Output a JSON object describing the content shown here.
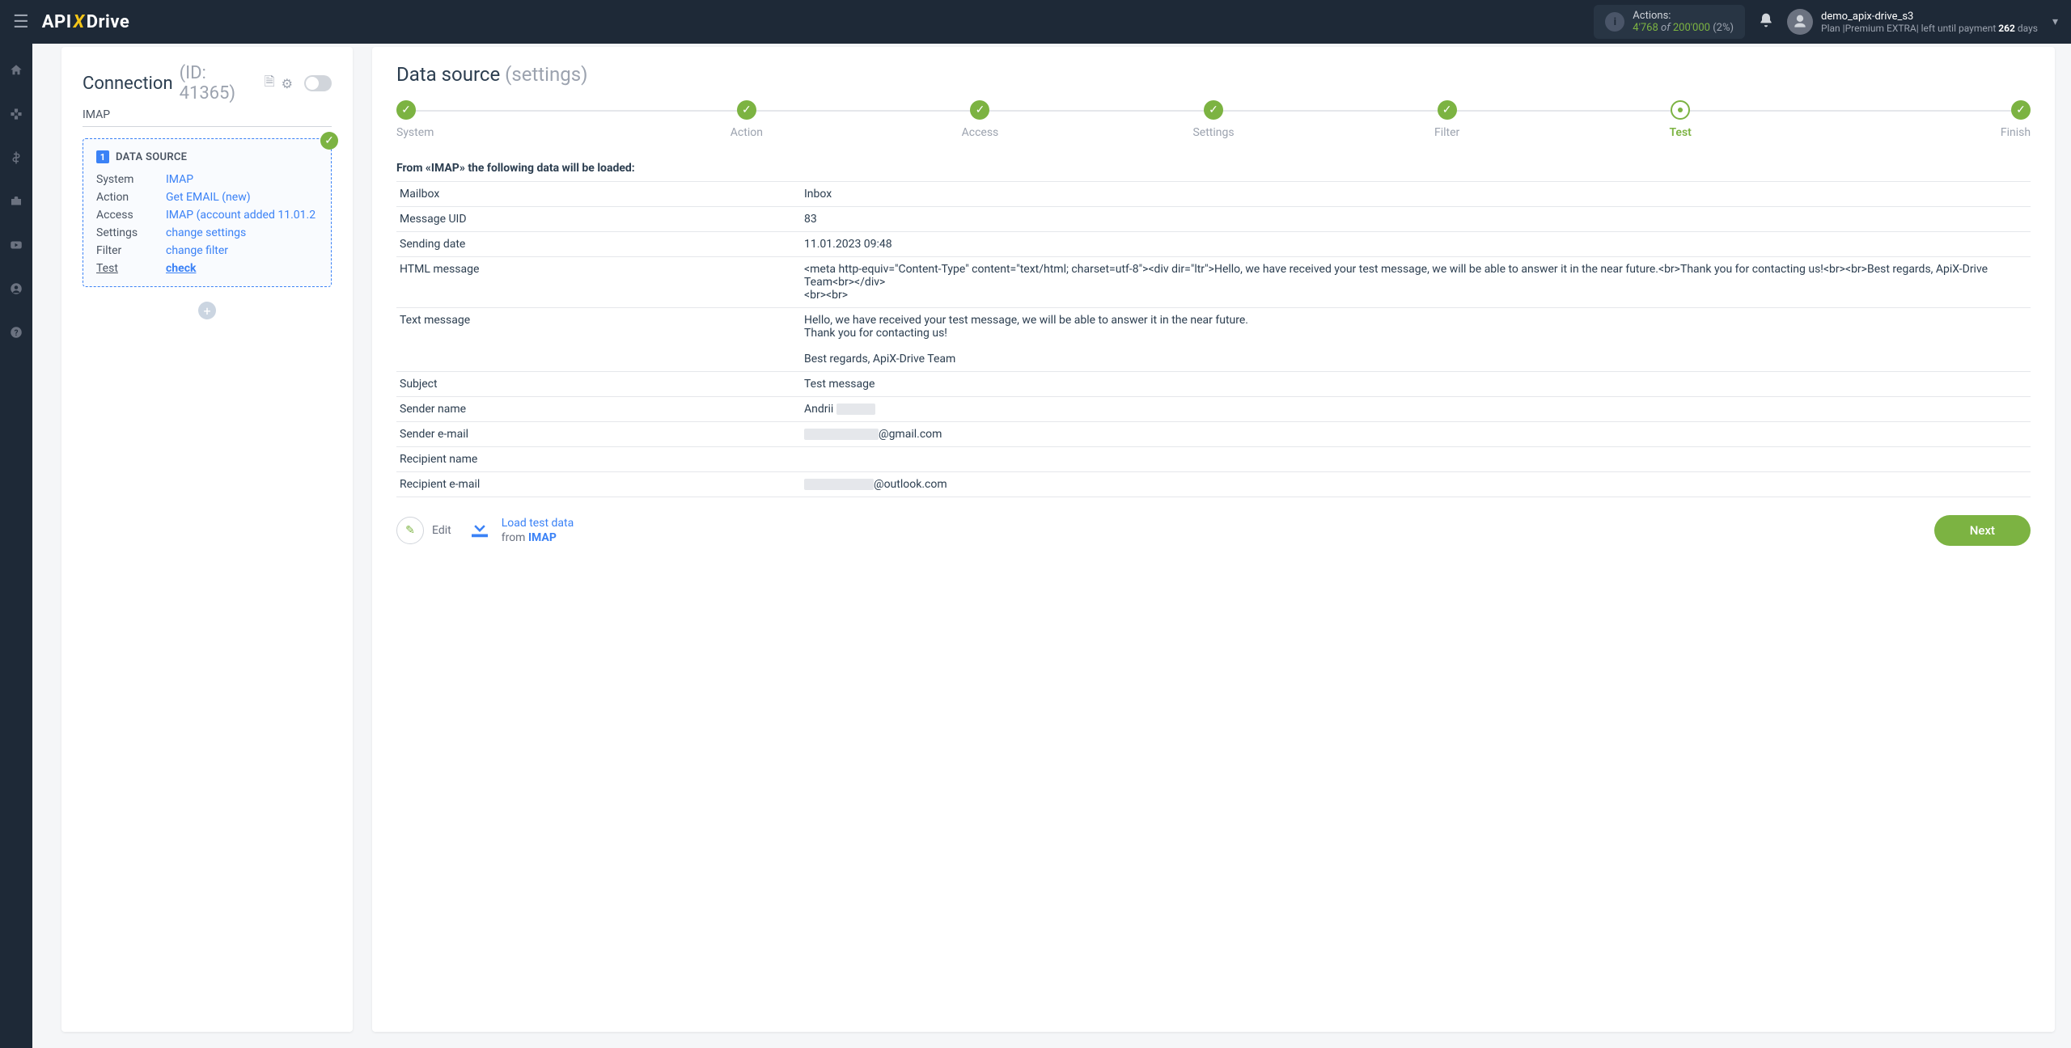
{
  "topbar": {
    "actions_label": "Actions:",
    "actions_current": "4'768",
    "actions_of": "of",
    "actions_max": "200'000",
    "actions_pct": "(2%)",
    "user_name": "demo_apix-drive_s3",
    "plan_prefix": "Plan  |",
    "plan_name": "Premium EXTRA",
    "plan_until": "|  left until payment ",
    "plan_days": "262",
    "plan_days_unit": " days"
  },
  "connection": {
    "title": "Connection",
    "id_label": "(ID: 41365)",
    "service": "IMAP",
    "ds_title": "DATA SOURCE",
    "rows": {
      "system_k": "System",
      "system_v": "IMAP",
      "action_k": "Action",
      "action_v": "Get EMAIL (new)",
      "access_k": "Access",
      "access_v": "IMAP (account added 11.01.2",
      "settings_k": "Settings",
      "settings_v": "change settings",
      "filter_k": "Filter",
      "filter_v": "change filter",
      "test_k": "Test",
      "test_v": "check"
    }
  },
  "datasource": {
    "title": "Data source",
    "subtitle": "(settings)",
    "steps": [
      "System",
      "Action",
      "Access",
      "Settings",
      "Filter",
      "Test",
      "Finish"
    ],
    "from_label": "From «IMAP» the following data will be loaded:",
    "table": {
      "mailbox_k": "Mailbox",
      "mailbox_v": "Inbox",
      "uid_k": "Message UID",
      "uid_v": "83",
      "date_k": "Sending date",
      "date_v": "11.01.2023 09:48",
      "html_k": "HTML message",
      "html_v": "<meta http-equiv=\"Content-Type\" content=\"text/html; charset=utf-8\"><div dir=\"ltr\">Hello, we have received your test message, we will be able to answer it in the near future.<br>Thank you for contacting us!<br><br>Best regards, ApiX-Drive Team<br></div>\n<br><br>",
      "text_k": "Text message",
      "text_v": "Hello, we have received your test message, we will be able to answer it in the near future.\nThank you for contacting us!\n\nBest regards, ApiX-Drive Team",
      "subject_k": "Subject",
      "subject_v": "Test message",
      "sname_k": "Sender name",
      "sname_v": "Andrii ",
      "semail_k": "Sender e-mail",
      "semail_suffix": "@gmail.com",
      "rname_k": "Recipient name",
      "rname_v": "",
      "remail_k": "Recipient e-mail",
      "remail_suffix": "@outlook.com"
    },
    "edit_label": "Edit",
    "load_line1": "Load test data",
    "load_from": "from ",
    "load_service": "IMAP",
    "next_label": "Next"
  }
}
